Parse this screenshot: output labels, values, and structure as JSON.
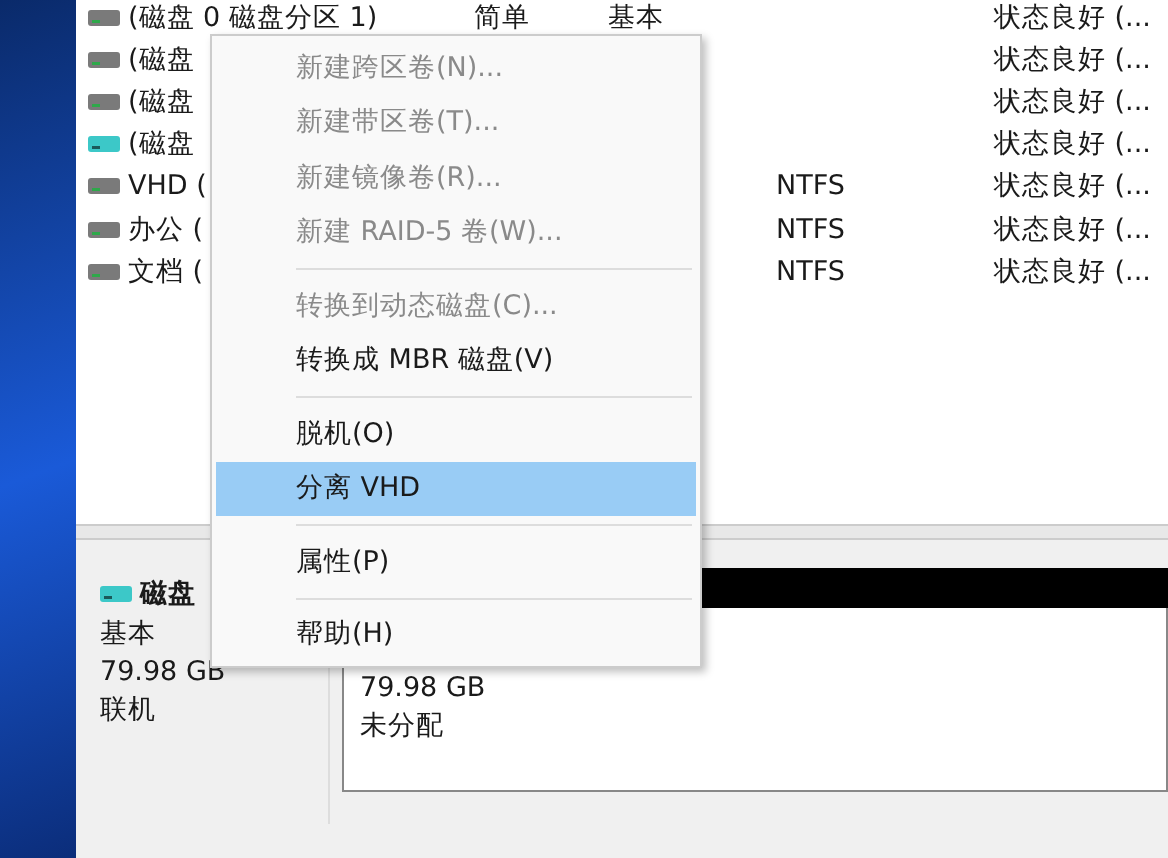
{
  "volumes": [
    {
      "name": "(磁盘 0 磁盘分区 1)",
      "layout": "简单",
      "type": "基本",
      "status": "状态良好 (...",
      "highlight": false
    },
    {
      "name": "(磁盘",
      "status": "状态良好 (...",
      "highlight": false
    },
    {
      "name": "(磁盘",
      "status": "状态良好 (...",
      "highlight": false
    },
    {
      "name": "(磁盘",
      "status": "状态良好 (...",
      "highlight": true
    },
    {
      "name": "VHD (",
      "fs": "NTFS",
      "status": "状态良好 (...",
      "highlight": false
    },
    {
      "name": "办公 (",
      "fs": "NTFS",
      "status": "状态良好 (...",
      "highlight": false
    },
    {
      "name": "文档 (",
      "fs": "NTFS",
      "status": "状态良好 (...",
      "highlight": false
    }
  ],
  "disk": {
    "name": "磁盘",
    "type": "基本",
    "size": "79.98 GB",
    "state": "联机"
  },
  "partition": {
    "size": "79.98 GB",
    "label": "未分配"
  },
  "context_menu": [
    {
      "kind": "item",
      "label": "新建跨区卷(N)...",
      "disabled": true,
      "selected": false
    },
    {
      "kind": "item",
      "label": "新建带区卷(T)...",
      "disabled": true,
      "selected": false
    },
    {
      "kind": "item",
      "label": "新建镜像卷(R)...",
      "disabled": true,
      "selected": false
    },
    {
      "kind": "item",
      "label": "新建 RAID-5 卷(W)...",
      "disabled": true,
      "selected": false
    },
    {
      "kind": "separator"
    },
    {
      "kind": "item",
      "label": "转换到动态磁盘(C)...",
      "disabled": true,
      "selected": false
    },
    {
      "kind": "item",
      "label": "转换成 MBR 磁盘(V)",
      "disabled": false,
      "selected": false
    },
    {
      "kind": "separator"
    },
    {
      "kind": "item",
      "label": "脱机(O)",
      "disabled": false,
      "selected": false
    },
    {
      "kind": "item",
      "label": "分离 VHD",
      "disabled": false,
      "selected": true
    },
    {
      "kind": "separator"
    },
    {
      "kind": "item",
      "label": "属性(P)",
      "disabled": false,
      "selected": false
    },
    {
      "kind": "separator"
    },
    {
      "kind": "item",
      "label": "帮助(H)",
      "disabled": false,
      "selected": false
    }
  ]
}
